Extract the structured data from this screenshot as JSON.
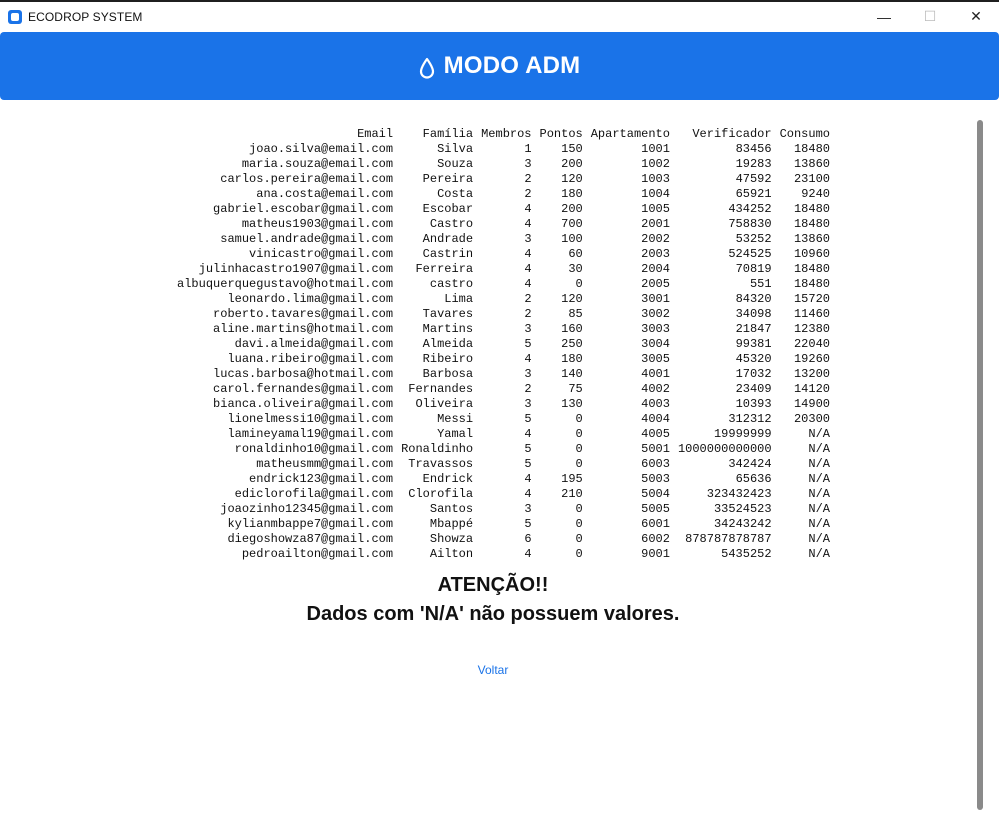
{
  "window": {
    "title": "ECODROP SYSTEM",
    "minimize_glyph": "—",
    "maximize_glyph": "☐",
    "close_glyph": "✕"
  },
  "header": {
    "title": "MODO ADM",
    "icon": "water-drop-icon"
  },
  "table": {
    "columns": [
      "Email",
      "Família",
      "Membros",
      "Pontos",
      "Apartamento",
      "Verificador",
      "Consumo"
    ],
    "rows": [
      [
        "joao.silva@email.com",
        "Silva",
        "1",
        "150",
        "1001",
        "83456",
        "18480"
      ],
      [
        "maria.souza@email.com",
        "Souza",
        "3",
        "200",
        "1002",
        "19283",
        "13860"
      ],
      [
        "carlos.pereira@email.com",
        "Pereira",
        "2",
        "120",
        "1003",
        "47592",
        "23100"
      ],
      [
        "ana.costa@email.com",
        "Costa",
        "2",
        "180",
        "1004",
        "65921",
        "9240"
      ],
      [
        "gabriel.escobar@gmail.com",
        "Escobar",
        "4",
        "200",
        "1005",
        "434252",
        "18480"
      ],
      [
        "matheus1903@gmail.com",
        "Castro",
        "4",
        "700",
        "2001",
        "758830",
        "18480"
      ],
      [
        "samuel.andrade@gmail.com",
        "Andrade",
        "3",
        "100",
        "2002",
        "53252",
        "13860"
      ],
      [
        "vinicastro@gmail.com",
        "Castrin",
        "4",
        "60",
        "2003",
        "524525",
        "10960"
      ],
      [
        "julinhacastro1907@gmail.com",
        "Ferreira",
        "4",
        "30",
        "2004",
        "70819",
        "18480"
      ],
      [
        "albuquerquegustavo@hotmail.com",
        "castro",
        "4",
        "0",
        "2005",
        "551",
        "18480"
      ],
      [
        "leonardo.lima@gmail.com",
        "Lima",
        "2",
        "120",
        "3001",
        "84320",
        "15720"
      ],
      [
        "roberto.tavares@gmail.com",
        "Tavares",
        "2",
        "85",
        "3002",
        "34098",
        "11460"
      ],
      [
        "aline.martins@hotmail.com",
        "Martins",
        "3",
        "160",
        "3003",
        "21847",
        "12380"
      ],
      [
        "davi.almeida@gmail.com",
        "Almeida",
        "5",
        "250",
        "3004",
        "99381",
        "22040"
      ],
      [
        "luana.ribeiro@gmail.com",
        "Ribeiro",
        "4",
        "180",
        "3005",
        "45320",
        "19260"
      ],
      [
        "lucas.barbosa@hotmail.com",
        "Barbosa",
        "3",
        "140",
        "4001",
        "17032",
        "13200"
      ],
      [
        "carol.fernandes@gmail.com",
        "Fernandes",
        "2",
        "75",
        "4002",
        "23409",
        "14120"
      ],
      [
        "bianca.oliveira@gmail.com",
        "Oliveira",
        "3",
        "130",
        "4003",
        "10393",
        "14900"
      ],
      [
        "lionelmessi10@gmail.com",
        "Messi",
        "5",
        "0",
        "4004",
        "312312",
        "20300"
      ],
      [
        "lamineyamal19@gmail.com",
        "Yamal",
        "4",
        "0",
        "4005",
        "19999999",
        "N/A"
      ],
      [
        "ronaldinho10@gmail.com",
        "Ronaldinho",
        "5",
        "0",
        "5001",
        "1000000000000",
        "N/A"
      ],
      [
        "matheusmm@gmail.com",
        "Travassos",
        "5",
        "0",
        "6003",
        "342424",
        "N/A"
      ],
      [
        "endrick123@gmail.com",
        "Endrick",
        "4",
        "195",
        "5003",
        "65636",
        "N/A"
      ],
      [
        "ediclorofila@gmail.com",
        "Clorofila",
        "4",
        "210",
        "5004",
        "323432423",
        "N/A"
      ],
      [
        "joaozinho12345@gmail.com",
        "Santos",
        "3",
        "0",
        "5005",
        "33524523",
        "N/A"
      ],
      [
        "kylianmbappe7@gmail.com",
        "Mbappé",
        "5",
        "0",
        "6001",
        "34243242",
        "N/A"
      ],
      [
        "diegoshowza87@gmail.com",
        "Showza",
        "6",
        "0",
        "6002",
        "878787878787",
        "N/A"
      ],
      [
        "pedroailton@gmail.com",
        "Ailton",
        "4",
        "0",
        "9001",
        "5435252",
        "N/A"
      ]
    ]
  },
  "notice": {
    "title": "ATENÇÃO!!",
    "text": "Dados com 'N/A' não possuem valores."
  },
  "back_link": "Voltar",
  "colors": {
    "accent": "#1a73e8",
    "scrollbar": "#8a8a8a"
  }
}
